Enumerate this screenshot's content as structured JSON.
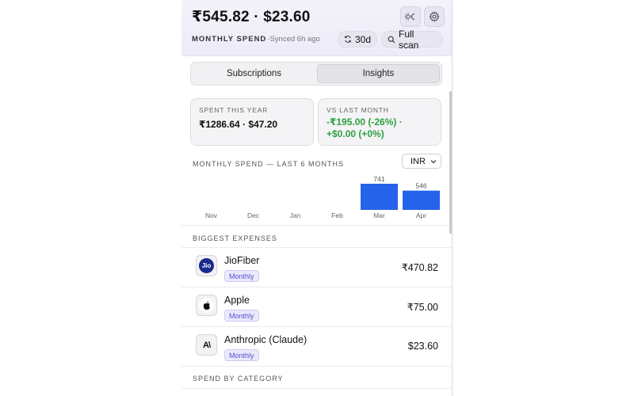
{
  "header": {
    "total": "₹545.82 · $23.60",
    "subtitle": "MONTHLY SPEND",
    "synced": "·Synced 6h ago",
    "period_label": "30d",
    "scan_label": "Full scan",
    "icons": [
      "theme-toggle-icon",
      "gear-icon",
      "refresh-icon",
      "search-icon"
    ]
  },
  "tabs": [
    {
      "label": "Subscriptions",
      "active": false
    },
    {
      "label": "Insights",
      "active": true
    }
  ],
  "cards": {
    "spent_year": {
      "label": "SPENT THIS YEAR",
      "value": "₹1286.64 · $47.20"
    },
    "vs_last_month": {
      "label": "VS LAST MONTH",
      "value_line1": "-₹195.00 (-26%) ·",
      "value_line2": "+$0.00 (+0%)",
      "color": "#2ea043"
    }
  },
  "chart_section": {
    "title": "MONTHLY SPEND — LAST 6 MONTHS",
    "currency": "INR"
  },
  "chart_data": {
    "type": "bar",
    "categories": [
      "Nov",
      "Dec",
      "Jan",
      "Feb",
      "Mar",
      "Apr"
    ],
    "values": [
      0,
      0,
      0,
      0,
      741,
      546
    ],
    "value_labels": [
      "",
      "",
      "",
      "",
      "741",
      "546"
    ],
    "title": "MONTHLY SPEND — LAST 6 MONTHS",
    "ylim": [
      0,
      741
    ],
    "bar_color": "#2563eb",
    "grid": false
  },
  "biggest_expenses": {
    "title": "BIGGEST EXPENSES",
    "items": [
      {
        "name": "JioFiber",
        "badge": "Monthly",
        "amount": "₹470.82",
        "logo": "Jio",
        "icon": "jio-logo-icon"
      },
      {
        "name": "Apple",
        "badge": "Monthly",
        "amount": "₹75.00",
        "logo": "",
        "icon": "apple-logo-icon"
      },
      {
        "name": "Anthropic (Claude)",
        "badge": "Monthly",
        "amount": "$23.60",
        "logo": "A\\",
        "icon": "anthropic-logo-icon"
      }
    ]
  },
  "category_section": {
    "title": "SPEND BY CATEGORY"
  },
  "colors": {
    "accent": "#5a4fcf",
    "bar": "#2563eb",
    "positive": "#2ea043"
  }
}
